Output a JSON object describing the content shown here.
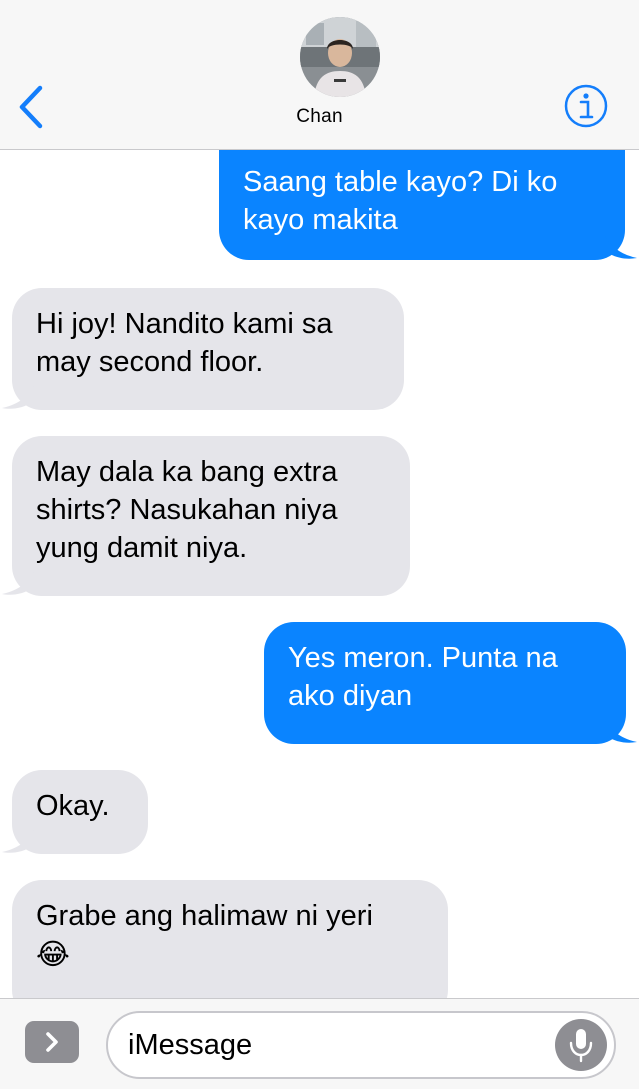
{
  "header": {
    "contact_name": "Chan",
    "back_icon": "chevron-left-icon",
    "info_icon": "info-circle-icon",
    "accent_color": "#147efb"
  },
  "messages": [
    {
      "direction": "sent",
      "text": "Saang table kayo? Di ko kayo makita"
    },
    {
      "direction": "received",
      "text": "Hi joy! Nandito kami sa may second floor."
    },
    {
      "direction": "received",
      "text": "May dala ka bang extra shirts? Nasukahan niya yung damit niya."
    },
    {
      "direction": "sent",
      "text": "Yes meron. Punta na ako diyan"
    },
    {
      "direction": "received",
      "text": "Okay."
    },
    {
      "direction": "received",
      "text": "Grabe ang halimaw ni yeri",
      "emoji": "😂"
    }
  ],
  "composer": {
    "placeholder": "iMessage",
    "apps_icon": "chevron-right-icon",
    "mic_icon": "microphone-icon"
  },
  "colors": {
    "sent_bubble": "#0a84ff",
    "received_bubble": "#e5e5ea"
  }
}
